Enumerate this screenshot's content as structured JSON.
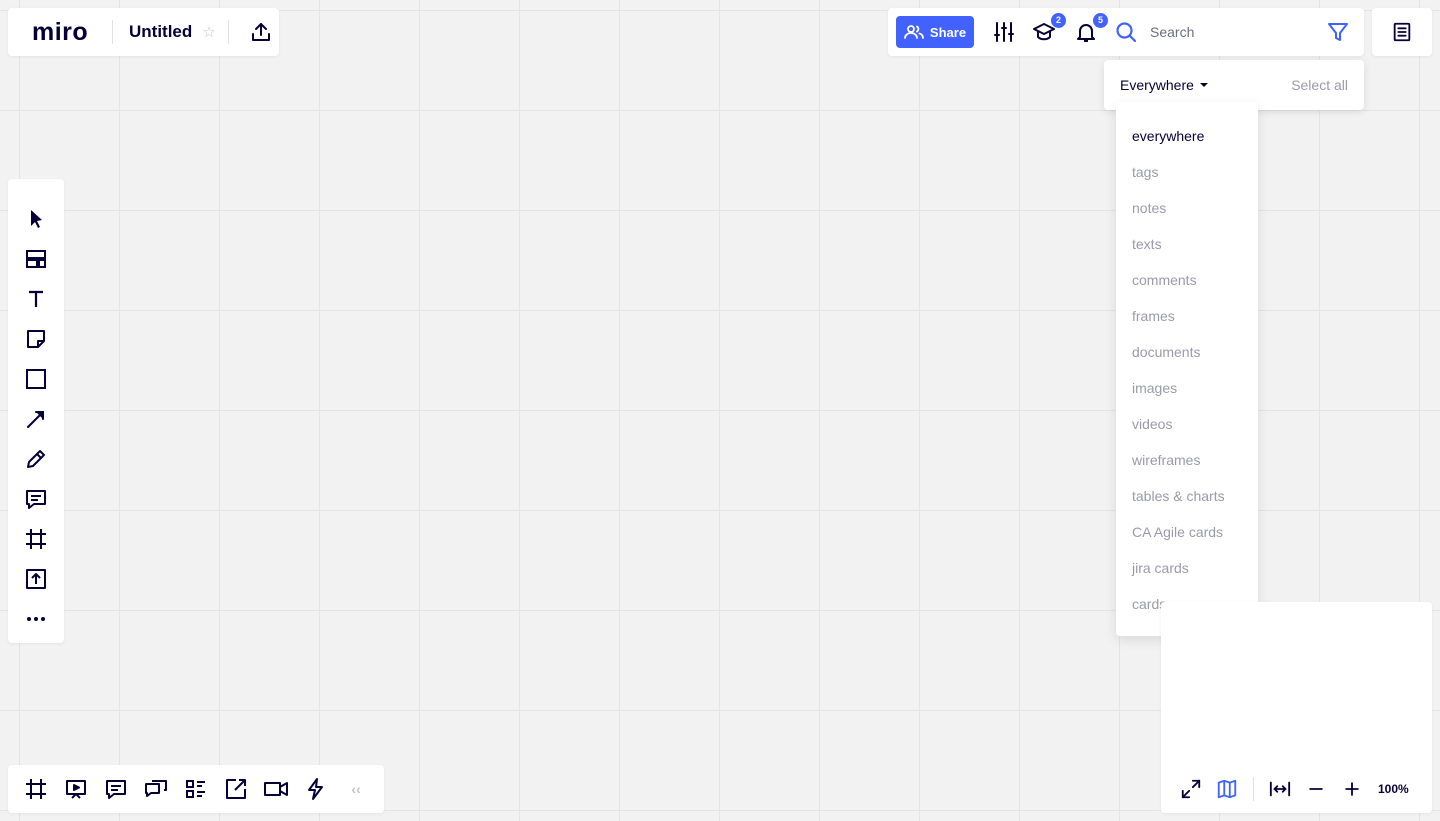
{
  "app": {
    "logo": "miro",
    "board_title": "Untitled"
  },
  "header": {
    "share_label": "Share",
    "learning_badge": "2",
    "notifications_badge": "5",
    "search_placeholder": "Search"
  },
  "filter": {
    "scope_label": "Everywhere",
    "select_all_label": "Select all",
    "options": [
      "everywhere",
      "tags",
      "notes",
      "texts",
      "comments",
      "frames",
      "documents",
      "images",
      "videos",
      "wireframes",
      "tables & charts",
      "CA Agile cards",
      "jira cards",
      "cards"
    ],
    "selected": "everywhere"
  },
  "left_toolbar": {
    "tools": [
      "select-icon",
      "templates-icon",
      "text-icon",
      "sticky-note-icon",
      "shape-icon",
      "connection-line-icon",
      "pen-icon",
      "comment-icon",
      "frame-icon",
      "upload-icon",
      "more-icon"
    ]
  },
  "bottom_toolbar": {
    "tools": [
      "frames-icon",
      "presentation-icon",
      "comments-icon",
      "chat-icon",
      "card-list-icon",
      "screen-share-icon",
      "video-call-icon",
      "activity-icon"
    ],
    "collapse_label": "‹‹"
  },
  "zoom": {
    "level": "100%"
  },
  "colors": {
    "accent": "#4262ff",
    "text_primary": "#050038",
    "text_muted": "#9a9aaa",
    "canvas": "#f2f2f2"
  }
}
